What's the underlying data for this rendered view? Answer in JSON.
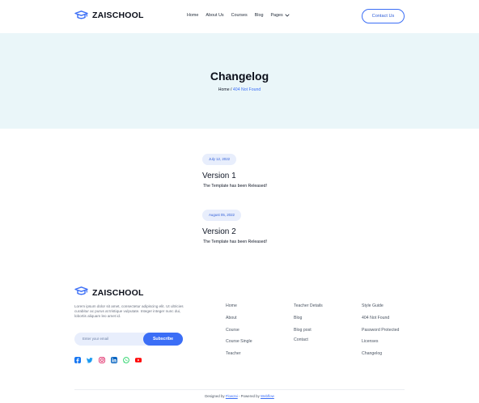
{
  "header": {
    "logo_text": "ZAISCHOOL",
    "nav": [
      "Home",
      "About Us",
      "Courses",
      "Blog",
      "Pages"
    ],
    "cta": "Contact Us"
  },
  "hero": {
    "title": "Changelog",
    "breadcrumb_home": "Home",
    "breadcrumb_sep": " / ",
    "breadcrumb_current": "404 Not Found"
  },
  "entries": [
    {
      "date": "July 12, 2022",
      "version": "Version 1",
      "description": "The Template has been Released!"
    },
    {
      "date": "August 05, 2022",
      "version": "Version 2",
      "description": "The Template has been Released!"
    }
  ],
  "footer": {
    "logo_text": "ZAISCHOOL",
    "about_text": "Lorem ipsum dolor sit amet, consectetur adipiscing elit. Ut ultricies curabitur ac purus at tristique vulputate. Integer integer nunc dui, lobortis aliquam leo amet id.",
    "email_placeholder": "Enter your email",
    "subscribe_label": "Subscribe",
    "col1": [
      "Home",
      "About",
      "Course",
      "Course Single",
      "Teacher"
    ],
    "col2": [
      "Teacher Details",
      "Blog",
      "Blog post",
      "Contact"
    ],
    "col3": [
      "Style Guide",
      "404 Not Found",
      "Password Protected",
      "Licenses",
      "Changelog"
    ],
    "credit_prefix": "Designed by ",
    "credit_designer": "Flowzai",
    "credit_mid": " - Powered by ",
    "credit_platform": "Webflow"
  },
  "colors": {
    "accent": "#3b6ef6",
    "hero_bg": "#eaf6f9",
    "pill_bg": "#e8eefc"
  },
  "icons": [
    "graduation-cap-icon",
    "chevron-down-icon",
    "facebook-icon",
    "twitter-icon",
    "instagram-icon",
    "linkedin-icon",
    "whatsapp-icon",
    "youtube-icon"
  ]
}
